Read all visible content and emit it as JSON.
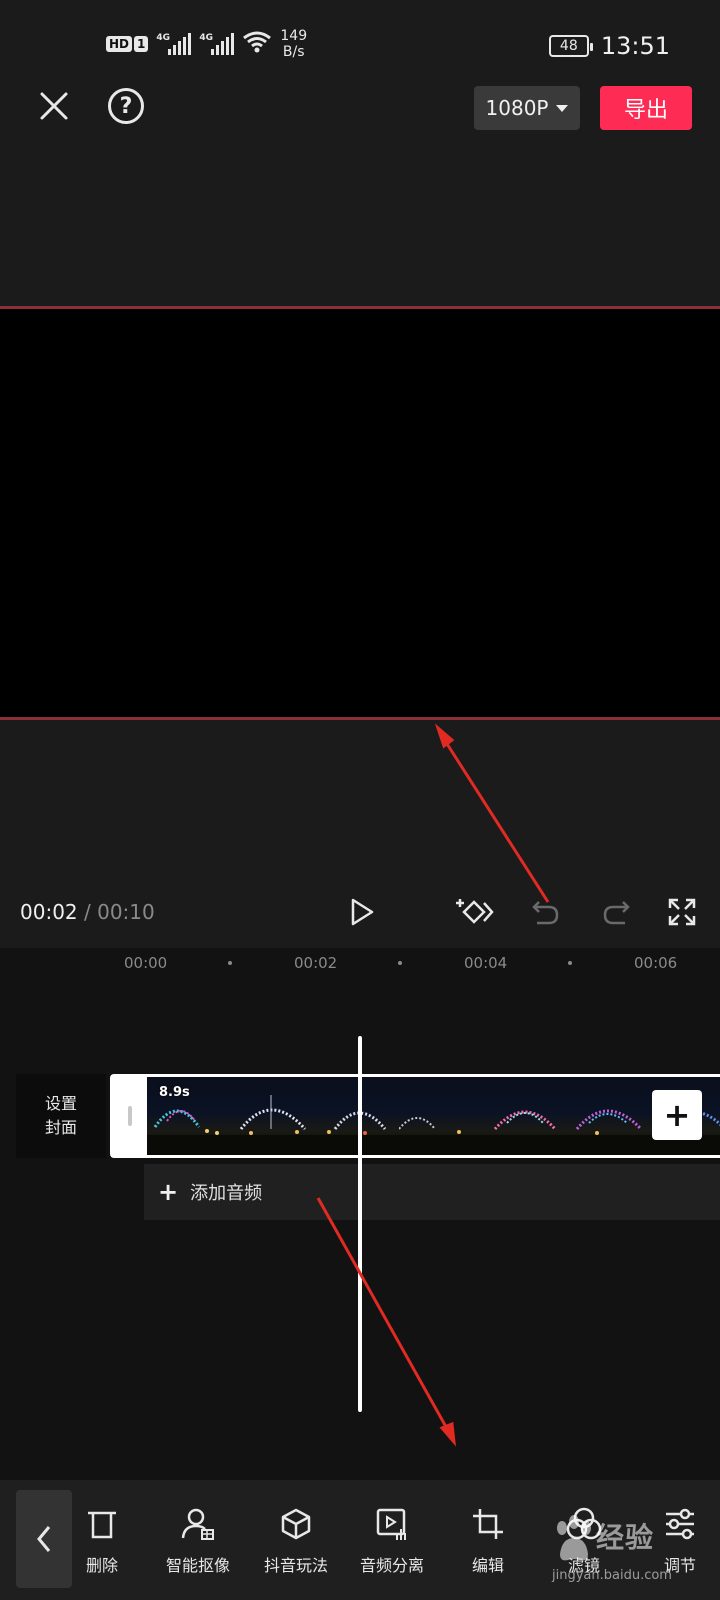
{
  "status_bar": {
    "hd_label": "HD",
    "sim_label": "1",
    "signal1_label": "4G",
    "signal2_label": "4G",
    "net_speed_value": "149",
    "net_speed_unit": "B/s",
    "battery": "48",
    "time": "13:51"
  },
  "toolbar": {
    "resolution_label": "1080P",
    "export_label": "导出",
    "help_glyph": "?"
  },
  "player": {
    "current_time": "00:02",
    "separator": " / ",
    "total_time": "00:10"
  },
  "ruler": {
    "labels": [
      "00:00",
      "00:02",
      "00:04",
      "00:06"
    ]
  },
  "timeline": {
    "cover_line1": "设置",
    "cover_line2": "封面",
    "clip_duration": "8.9s",
    "add_clip_glyph": "+",
    "add_audio_plus": "+",
    "add_audio_label": "添加音频"
  },
  "bottom_toolbar": {
    "tools": [
      {
        "label": "删除",
        "icon": "delete-icon"
      },
      {
        "label": "智能抠像",
        "icon": "smart-cutout-icon"
      },
      {
        "label": "抖音玩法",
        "icon": "cube-icon"
      },
      {
        "label": "音频分离",
        "icon": "audio-separate-icon"
      },
      {
        "label": "编辑",
        "icon": "crop-icon"
      },
      {
        "label": "滤镜",
        "icon": "filter-icon"
      },
      {
        "label": "调节",
        "icon": "adjust-icon"
      }
    ]
  },
  "watermark": {
    "brand": "经验",
    "url": "jingyan.baidu.com"
  },
  "colors": {
    "accent": "#fe2c55",
    "preview_border": "#8b3136",
    "annotation_arrow": "#e02a22"
  }
}
